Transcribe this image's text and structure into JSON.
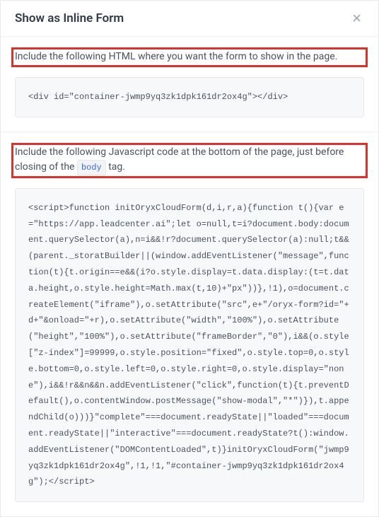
{
  "header": {
    "title": "Show as Inline Form",
    "close_label": "×"
  },
  "sections": {
    "html": {
      "instruction": "Include the following HTML where you want the form to show in the page.",
      "code": "<div id=\"container-jwmp9yq3zk1dpk161dr2ox4g\"></div>"
    },
    "js": {
      "instruction_pre": "Include the following Javascript code at the bottom of the page, just before closing of the ",
      "instruction_tag": "body",
      "instruction_post": " tag.",
      "code": "<script>function initOryxCloudForm(d,i,r,a){function t(){var e=\"https://app.leadcenter.ai\";let o=null,t=i?document.body:document.querySelector(a),n=i&&!r?document.querySelector(a):null;t&&(parent._storatBuilder||(window.addEventListener(\"message\",function(t){t.origin==e&&(i?o.style.display=t.data.display:(t=t.data.height,o.style.height=Math.max(t,10)+\"px\"))},!1),o=document.createElement(\"iframe\"),o.setAttribute(\"src\",e+\"/oryx-form?id=\"+d+\"&onload=\"+r),o.setAttribute(\"width\",\"100%\"),o.setAttribute(\"height\",\"100%\"),o.setAttribute(\"frameBorder\",\"0\"),i&&(o.style[\"z-index\"]=99999,o.style.position=\"fixed\",o.style.top=0,o.style.bottom=0,o.style.left=0,o.style.right=0,o.style.display=\"none\"),i&&!r&&n&&n.addEventListener(\"click\",function(t){t.preventDefault(),o.contentWindow.postMessage(\"show-modal\",\"*\")}),t.appendChild(o)))}\"complete\"===document.readyState||\"loaded\"===document.readyState||\"interactive\"===document.readyState?t():window.addEventListener(\"DOMContentLoaded\",t)}initOryxCloudForm(\"jwmp9yq3zk1dpk161dr2ox4g\",!1,!1,\"#container-jwmp9yq3zk1dpk161dr2ox4g\");</script>"
    }
  }
}
